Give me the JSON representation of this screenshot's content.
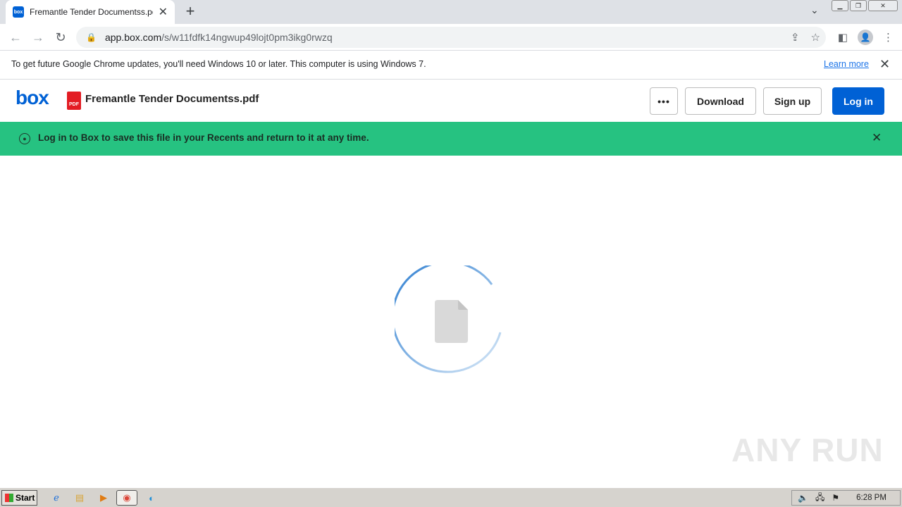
{
  "browser": {
    "tab_title": "Fremantle Tender Documentss.pdf |",
    "tab_favicon": "box",
    "url_host": "app.box.com",
    "url_path": "/s/w11fdfk14ngwup49lojt0pm3ikg0rwzq",
    "infobar_message": "To get future Google Chrome updates, you'll need Windows 10 or later. This computer is using Windows 7.",
    "infobar_link": "Learn more"
  },
  "box": {
    "logo": "box",
    "file_icon_label": "PDF",
    "file_name": "Fremantle Tender Documentss.pdf",
    "more_label": "•••",
    "download_label": "Download",
    "signup_label": "Sign up",
    "login_label": "Log in",
    "banner_message": "Log in to Box to save this file in your Recents and return to it at any time.",
    "accent_color": "#0061d5",
    "banner_color": "#26c281"
  },
  "watermark": "ANY RUN",
  "taskbar": {
    "start_label": "Start",
    "clock": "6:28 PM"
  }
}
